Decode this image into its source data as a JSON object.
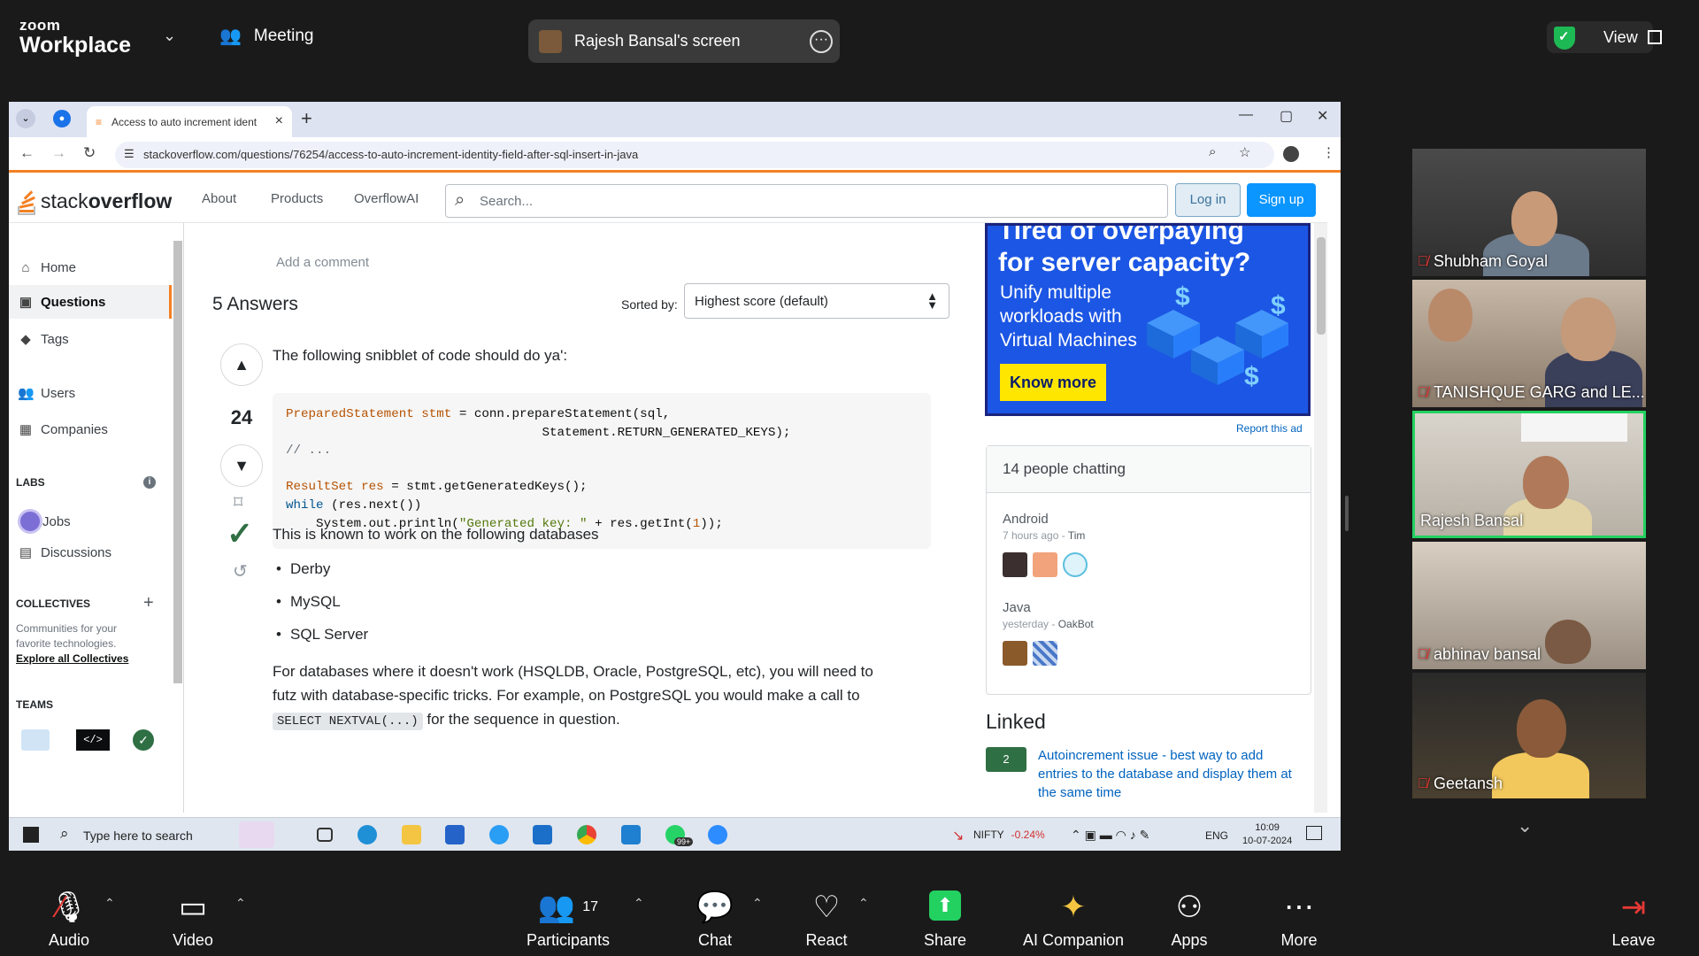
{
  "zoom": {
    "brand_top": "zoom",
    "brand_bottom": "Workplace",
    "meeting_label": "Meeting",
    "screen_label": "Rajesh Bansal's screen",
    "view_label": "View",
    "gallery": [
      {
        "name": "Shubham Goyal",
        "muted": true
      },
      {
        "name": "TANISHQUE GARG and LE...",
        "muted": true
      },
      {
        "name": "Rajesh Bansal",
        "muted": false,
        "active": true
      },
      {
        "name": "abhinav bansal",
        "muted": true
      },
      {
        "name": "Geetansh",
        "muted": true
      }
    ],
    "toolbar": {
      "audio": "Audio",
      "video": "Video",
      "participants": "Participants",
      "participants_count": "17",
      "chat": "Chat",
      "react": "React",
      "share": "Share",
      "ai": "AI Companion",
      "apps": "Apps",
      "more": "More",
      "leave": "Leave"
    }
  },
  "browser": {
    "tab_title": "Access to auto increment ident",
    "url": "stackoverflow.com/questions/76254/access-to-auto-increment-identity-field-after-sql-insert-in-java"
  },
  "so": {
    "brand_light": "stack",
    "brand_bold": "overflow",
    "nav": [
      "About",
      "Products",
      "OverflowAI"
    ],
    "search_placeholder": "Search...",
    "login": "Log in",
    "signup": "Sign up",
    "left": {
      "home": "Home",
      "questions": "Questions",
      "tags": "Tags",
      "users": "Users",
      "companies": "Companies",
      "labs": "LABS",
      "jobs": "Jobs",
      "discussions": "Discussions",
      "collectives": "COLLECTIVES",
      "collectives_desc1": "Communities for your",
      "collectives_desc2": "favorite technologies.",
      "explore": "Explore all Collectives",
      "teams": "TEAMS"
    },
    "main": {
      "add_comment": "Add a comment",
      "answers_title": "5 Answers",
      "sorted_by": "Sorted by:",
      "sort_value": "Highest score (default)",
      "score": "24",
      "intro": "The following snibblet of code should do ya':",
      "works_on": "This is known to work on the following databases",
      "databases": [
        "Derby",
        "MySQL",
        "SQL Server"
      ],
      "para1_line1": "For databases where it doesn't work (HSQLDB, Oracle, PostgreSQL, etc), you will need to",
      "para1_line2": "futz with database-specific tricks. For example, on PostgreSQL you would make a call to",
      "inline_code": "SELECT NEXTVAL(...)",
      "para1_line3": " for the sequence in question."
    },
    "code_lines": {
      "l1_type": "PreparedStatement",
      "l1_var": " stmt",
      "l1_rest": " = conn.prepareStatement(sql,",
      "l2": "                                  Statement.RETURN_GENERATED_KEYS);",
      "l3": "// ...",
      "l5_type": "ResultSet",
      "l5_var": " res",
      "l5_rest": " = stmt.getGeneratedKeys();",
      "l6_kw": "while",
      "l6_rest": " (res.next())",
      "l7_a": "    System.out.println(",
      "l7_str": "\"Generated key: \"",
      "l7_b": " + res.getInt(",
      "l7_num": "1",
      "l7_c": "));"
    },
    "ad": {
      "headline1": "Tired of overpaying",
      "headline2": "for server capacity?",
      "body1": "Unify multiple",
      "body2": "workloads with",
      "body3": "Virtual Machines",
      "cta": "Know more",
      "report": "Report this ad"
    },
    "chat": {
      "title": "14 people chatting",
      "rooms": [
        {
          "name": "Android",
          "when": "7 hours ago",
          "who": "Tim"
        },
        {
          "name": "Java",
          "when": "yesterday",
          "who": "OakBot"
        }
      ]
    },
    "linked": {
      "title": "Linked",
      "items": [
        {
          "score": "2",
          "text": "Autoincrement issue - best way to add entries to the database and display them at the same time"
        }
      ]
    }
  },
  "taskbar": {
    "search": "Type here to search",
    "whatsapp_badge": "99+",
    "nifty_label": "NIFTY",
    "nifty_change": "-0.24%",
    "lang": "ENG",
    "time": "10:09",
    "date": "10-07-2024"
  }
}
